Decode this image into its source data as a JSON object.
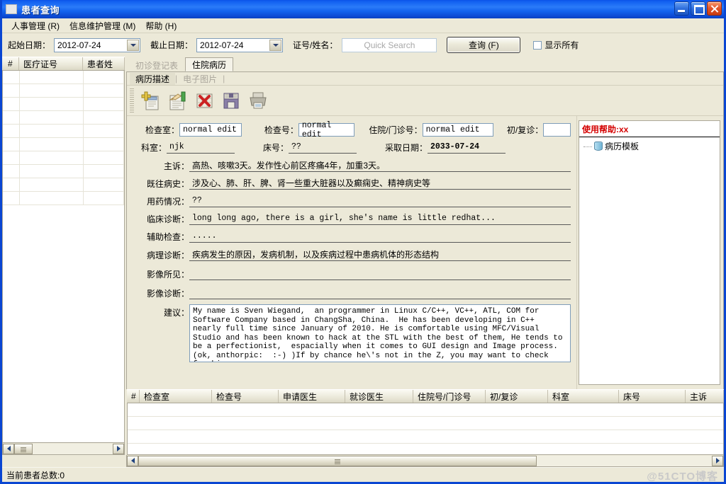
{
  "window": {
    "title": "患者查询",
    "icon": "window-icon",
    "buttons": {
      "minimize": "minimize-icon",
      "maximize": "maximize-icon",
      "close": "close-icon"
    }
  },
  "menubar": {
    "items": [
      {
        "label": "人事管理 (R)"
      },
      {
        "label": "信息维护管理 (M)"
      },
      {
        "label": "帮助 (H)"
      }
    ]
  },
  "filterbar": {
    "start_date_label": "起始日期：",
    "start_date_value": "2012-07-24",
    "end_date_label": "截止日期：",
    "end_date_value": "2012-07-24",
    "idname_label": "证号/姓名：",
    "search_placeholder": "Quick Search",
    "search_value": "",
    "query_button": "查询 (F)",
    "showall_label": "显示所有",
    "showall_checked": false
  },
  "left_grid": {
    "columns": [
      "#",
      "医疗证号",
      "患者姓"
    ],
    "rows": []
  },
  "tabs": {
    "outer": [
      {
        "label": "初诊登记表",
        "active": false
      },
      {
        "label": "住院病历",
        "active": true
      }
    ],
    "inner": [
      {
        "label": "病历描述",
        "active": true
      },
      {
        "label": "电子图片",
        "active": false
      }
    ]
  },
  "toolbar": {
    "buttons": [
      {
        "name": "add-record-icon",
        "title": "新增"
      },
      {
        "name": "edit-record-icon",
        "title": "编辑"
      },
      {
        "name": "delete-record-icon",
        "title": "删除"
      },
      {
        "name": "save-record-icon",
        "title": "保存"
      },
      {
        "name": "print-record-icon",
        "title": "打印"
      }
    ]
  },
  "form": {
    "exam_room_label": "检查室：",
    "exam_room_value": "normal edit",
    "exam_no_label": "检查号：",
    "exam_no_value": "normal edit",
    "admission_no_label": "住院/门诊号：",
    "admission_no_value": "normal edit",
    "visit_type_label": "初/复诊：",
    "visit_type_value": "",
    "dept_label": "科室：",
    "dept_value": "njk",
    "bed_label": "床号：",
    "bed_value": "??",
    "collect_date_label": "采取日期：",
    "collect_date_value": "2033-07-24",
    "chief_complaint_label": "主诉：",
    "chief_complaint_value": "高热、咳嗽3天。发作性心前区疼痛4年，加重3天。",
    "past_history_label": "既往病史：",
    "past_history_value": "涉及心、肺、肝、脾、肾一些重大脏器以及癫痫史、精神病史等",
    "medication_label": "用药情况：",
    "medication_value": "??",
    "clinical_dx_label": "临床诊断：",
    "clinical_dx_value": "long long ago, there is a girl, she's name is little redhat...",
    "aux_exam_label": "辅助检查：",
    "aux_exam_value": ".....",
    "patho_dx_label": "病理诊断：",
    "patho_dx_value": "疾病发生的原因，发病机制，以及疾病过程中患病机体的形态结构",
    "imaging_finding_label": "影像所见：",
    "imaging_finding_value": "",
    "imaging_dx_label": "影像诊断：",
    "imaging_dx_value": "",
    "suggestion_label": "建议：",
    "suggestion_value": "My name is Sven Wiegand,  an programmer in Linux C/C++, VC++, ATL, COM for Software Company based in ChangSha, China.  He has been developing in C++ nearly full time since January of 2010. He is comfortable using MFC/Visual Studio and has been known to hack at the STL with the best of them, He tends to be a perfectionist,  espacially when it comes to GUI design and Image process.  (ok, anthorpic:  :-) )If by chance he\\'s not in the Z, you may want to check for him..."
  },
  "help_panel": {
    "header": "使用帮助:xx",
    "tree": [
      {
        "label": "病历模板",
        "icon": "database-icon"
      }
    ]
  },
  "bottom_grid": {
    "columns": [
      "#",
      "检查室",
      "检查号",
      "申请医生",
      "就诊医生",
      "住院号/门诊号",
      "初/复诊",
      "科室",
      "床号",
      "主诉"
    ],
    "rows": []
  },
  "statusbar": {
    "text": "当前患者总数:0",
    "watermark": "@51CTO博客"
  },
  "colors": {
    "titlebar": "#1464ef",
    "window_border": "#0a46d2",
    "client_bg": "#ece9d8",
    "help_header": "#d40000",
    "input_border": "#7f9db9",
    "grid_border": "#aca899"
  }
}
